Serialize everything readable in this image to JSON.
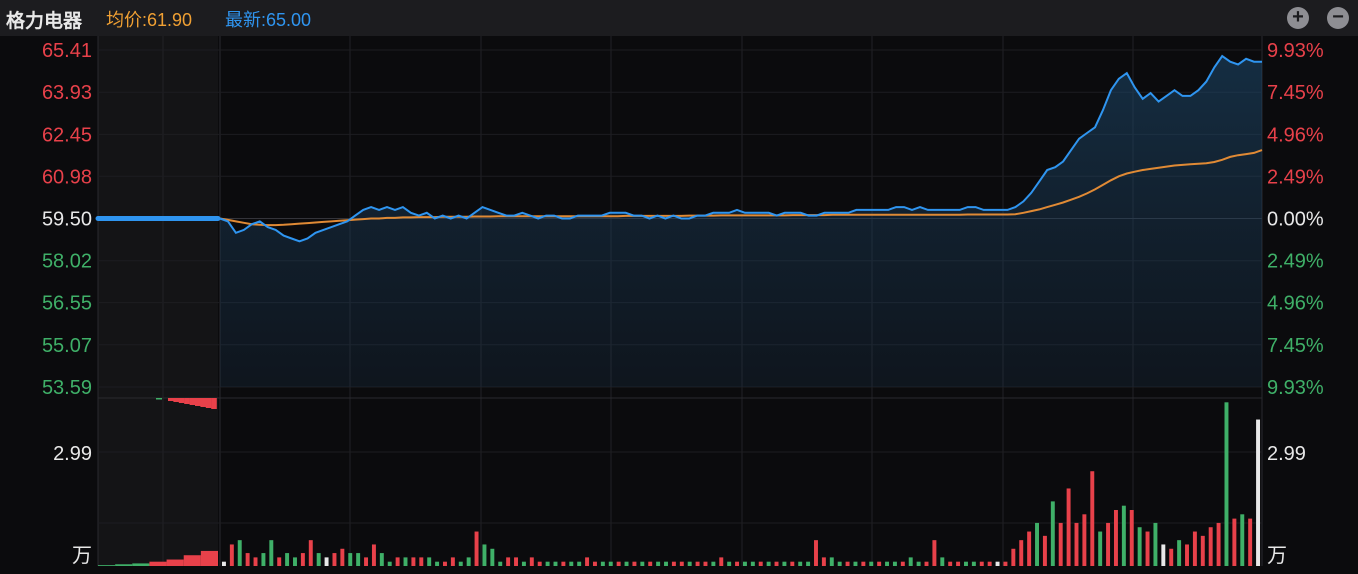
{
  "header": {
    "title": "格力电器",
    "avg_label": "均价:61.90",
    "latest_label": "最新:65.00",
    "zoom_in_icon": "plus-circle-icon",
    "zoom_out_icon": "minus-circle-icon"
  },
  "colors": {
    "up": "#e8414a",
    "down": "#3fb068",
    "neutral": "#e8e8e8",
    "price_line": "#2f95f0",
    "avg_line": "#e08a35"
  },
  "chart_data": [
    {
      "type": "line",
      "title": "",
      "y_ticks_left": [
        "65.41",
        "63.93",
        "62.45",
        "60.98",
        "59.50",
        "58.02",
        "56.55",
        "55.07",
        "53.59"
      ],
      "y_ticks_right": [
        "9.93%",
        "7.45%",
        "4.96%",
        "2.49%",
        "0.00%",
        "2.49%",
        "4.96%",
        "7.45%",
        "9.93%"
      ],
      "ylim": [
        53.59,
        65.41
      ],
      "prev_close": 59.5,
      "auction_price": 59.5,
      "series": [
        {
          "name": "最新",
          "values": [
            59.5,
            59.4,
            59.0,
            59.1,
            59.3,
            59.4,
            59.2,
            59.1,
            58.9,
            58.8,
            58.7,
            58.8,
            59.0,
            59.1,
            59.2,
            59.3,
            59.4,
            59.6,
            59.8,
            59.9,
            59.8,
            59.9,
            59.8,
            59.9,
            59.7,
            59.6,
            59.7,
            59.5,
            59.6,
            59.5,
            59.6,
            59.5,
            59.7,
            59.9,
            59.8,
            59.7,
            59.6,
            59.6,
            59.7,
            59.6,
            59.5,
            59.6,
            59.6,
            59.5,
            59.5,
            59.6,
            59.6,
            59.6,
            59.6,
            59.7,
            59.7,
            59.7,
            59.6,
            59.6,
            59.5,
            59.6,
            59.5,
            59.6,
            59.5,
            59.5,
            59.6,
            59.6,
            59.7,
            59.7,
            59.7,
            59.8,
            59.7,
            59.7,
            59.7,
            59.7,
            59.6,
            59.7,
            59.7,
            59.7,
            59.6,
            59.6,
            59.7,
            59.7,
            59.7,
            59.7,
            59.8,
            59.8,
            59.8,
            59.8,
            59.8,
            59.9,
            59.9,
            59.8,
            59.9,
            59.8,
            59.8,
            59.8,
            59.8,
            59.8,
            59.9,
            59.9,
            59.8,
            59.8,
            59.8,
            59.8,
            59.9,
            60.1,
            60.4,
            60.8,
            61.2,
            61.3,
            61.5,
            61.9,
            62.3,
            62.5,
            62.7,
            63.3,
            64.0,
            64.4,
            64.6,
            64.1,
            63.7,
            63.9,
            63.6,
            63.8,
            64.0,
            63.8,
            63.8,
            64.0,
            64.3,
            64.8,
            65.2,
            65.0,
            64.9,
            65.1,
            65.0,
            65.0
          ]
        },
        {
          "name": "均价",
          "values": [
            59.5,
            59.45,
            59.4,
            59.35,
            59.3,
            59.28,
            59.27,
            59.27,
            59.28,
            59.3,
            59.32,
            59.34,
            59.36,
            59.38,
            59.4,
            59.42,
            59.44,
            59.46,
            59.48,
            59.5,
            59.5,
            59.52,
            59.52,
            59.54,
            59.54,
            59.55,
            59.55,
            59.55,
            59.56,
            59.56,
            59.56,
            59.56,
            59.57,
            59.57,
            59.57,
            59.58,
            59.58,
            59.58,
            59.58,
            59.58,
            59.58,
            59.58,
            59.58,
            59.58,
            59.58,
            59.58,
            59.58,
            59.58,
            59.58,
            59.58,
            59.58,
            59.59,
            59.59,
            59.59,
            59.59,
            59.59,
            59.59,
            59.59,
            59.59,
            59.6,
            59.6,
            59.6,
            59.6,
            59.61,
            59.61,
            59.61,
            59.61,
            59.61,
            59.61,
            59.61,
            59.61,
            59.61,
            59.62,
            59.62,
            59.62,
            59.62,
            59.62,
            59.63,
            59.63,
            59.63,
            59.63,
            59.63,
            59.63,
            59.63,
            59.63,
            59.63,
            59.63,
            59.63,
            59.63,
            59.63,
            59.63,
            59.63,
            59.63,
            59.63,
            59.64,
            59.64,
            59.64,
            59.64,
            59.64,
            59.64,
            59.65,
            59.7,
            59.76,
            59.82,
            59.9,
            59.98,
            60.06,
            60.16,
            60.26,
            60.38,
            60.52,
            60.68,
            60.84,
            60.98,
            61.08,
            61.14,
            61.2,
            61.24,
            61.28,
            61.32,
            61.36,
            61.38,
            61.4,
            61.42,
            61.44,
            61.48,
            61.56,
            61.66,
            61.72,
            61.76,
            61.8,
            61.9
          ]
        }
      ]
    },
    {
      "type": "bar",
      "title": "",
      "y_ticks_left": [
        "2.99",
        "万"
      ],
      "y_ticks_right": [
        "2.99",
        "万"
      ],
      "volume_values": [
        0.1,
        0.5,
        0.6,
        0.3,
        0.2,
        0.3,
        0.6,
        0.2,
        0.3,
        0.2,
        0.3,
        0.6,
        0.3,
        0.2,
        0.3,
        0.4,
        0.3,
        0.3,
        0.2,
        0.5,
        0.3,
        0.1,
        0.2,
        0.2,
        0.2,
        0.2,
        0.2,
        0.1,
        0.1,
        0.2,
        0.1,
        0.2,
        0.8,
        0.5,
        0.4,
        0.1,
        0.2,
        0.2,
        0.1,
        0.2,
        0.1,
        0.1,
        0.1,
        0.1,
        0.1,
        0.1,
        0.2,
        0.1,
        0.1,
        0.1,
        0.1,
        0.1,
        0.1,
        0.1,
        0.1,
        0.1,
        0.1,
        0.1,
        0.1,
        0.1,
        0.1,
        0.1,
        0.1,
        0.2,
        0.1,
        0.1,
        0.1,
        0.1,
        0.1,
        0.1,
        0.1,
        0.1,
        0.1,
        0.1,
        0.1,
        0.6,
        0.2,
        0.2,
        0.1,
        0.1,
        0.1,
        0.1,
        0.1,
        0.1,
        0.1,
        0.1,
        0.1,
        0.2,
        0.1,
        0.1,
        0.6,
        0.2,
        0.1,
        0.1,
        0.1,
        0.1,
        0.1,
        0.1,
        0.1,
        0.1,
        0.4,
        0.6,
        0.8,
        1.0,
        0.7,
        1.5,
        1.0,
        1.8,
        1.0,
        1.2,
        2.2,
        0.8,
        1.0,
        1.3,
        1.4,
        1.3,
        0.9,
        0.8,
        1.0,
        0.5,
        0.4,
        0.6,
        0.5,
        0.8,
        0.7,
        0.9,
        1.0,
        3.8,
        1.1,
        1.2,
        1.1,
        3.4
      ],
      "volume_dir": [
        "w",
        "u",
        "d",
        "u",
        "u",
        "d",
        "d",
        "u",
        "d",
        "d",
        "u",
        "u",
        "d",
        "w",
        "u",
        "u",
        "d",
        "d",
        "u",
        "u",
        "d",
        "d",
        "u",
        "d",
        "u",
        "u",
        "d",
        "d",
        "u",
        "u",
        "d",
        "d",
        "u",
        "d",
        "d",
        "d",
        "u",
        "u",
        "d",
        "u",
        "u",
        "d",
        "d",
        "u",
        "d",
        "d",
        "u",
        "u",
        "d",
        "d",
        "u",
        "d",
        "u",
        "d",
        "u",
        "d",
        "d",
        "u",
        "u",
        "d",
        "u",
        "u",
        "d",
        "u",
        "d",
        "u",
        "d",
        "d",
        "u",
        "d",
        "u",
        "d",
        "u",
        "d",
        "d",
        "u",
        "u",
        "d",
        "d",
        "u",
        "d",
        "u",
        "d",
        "u",
        "d",
        "d",
        "u",
        "d",
        "d",
        "u",
        "u",
        "d",
        "u",
        "u",
        "d",
        "d",
        "u",
        "u",
        "w",
        "u",
        "u",
        "u",
        "u",
        "d",
        "u",
        "d",
        "u",
        "u",
        "u",
        "u",
        "u",
        "d",
        "u",
        "u",
        "d",
        "u",
        "d",
        "u",
        "d",
        "w",
        "u",
        "d",
        "u",
        "u",
        "u",
        "u",
        "u",
        "d",
        "u",
        "d",
        "u"
      ],
      "auction_volume": [
        0.02,
        0.04,
        0.06,
        0.1,
        0.15,
        0.25,
        0.35
      ]
    }
  ]
}
